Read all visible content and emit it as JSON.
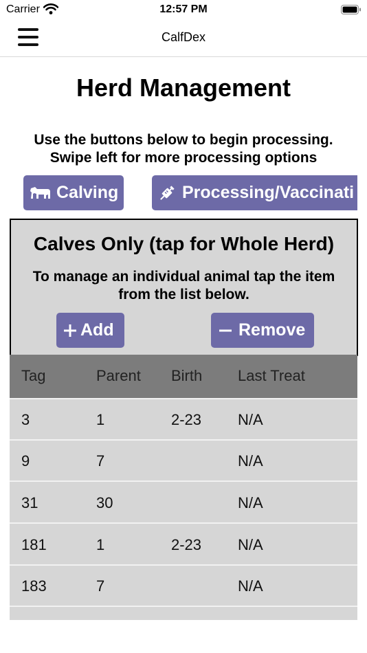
{
  "status_bar": {
    "carrier": "Carrier",
    "time": "12:57 PM"
  },
  "nav": {
    "title": "CalfDex"
  },
  "page": {
    "title": "Herd Management",
    "instructions": "Use the buttons below to begin processing. Swipe left for more processing options"
  },
  "actions": {
    "calving_label": "Calving",
    "calving_icon": "cow-icon",
    "processing_label": "Processing/Vaccinati",
    "processing_icon": "syringe-icon"
  },
  "panel": {
    "title": "Calves Only (tap for Whole Herd)",
    "instructions": "To manage an individual animal tap the item from the list below.",
    "add_label": "Add",
    "remove_label": "Remove"
  },
  "table": {
    "columns": [
      "Tag",
      "Parent",
      "Birth",
      "Last Treat"
    ],
    "rows": [
      [
        "3",
        "1",
        "2-23",
        "N/A"
      ],
      [
        "9",
        "7",
        "",
        "N/A"
      ],
      [
        "31",
        "30",
        "",
        "N/A"
      ],
      [
        "181",
        "1",
        "2-23",
        "N/A"
      ],
      [
        "183",
        "7",
        "",
        "N/A"
      ]
    ]
  },
  "colors": {
    "button": "#6d6aa7",
    "panel": "#d6d6d6",
    "table_header": "#7c7c7c"
  }
}
